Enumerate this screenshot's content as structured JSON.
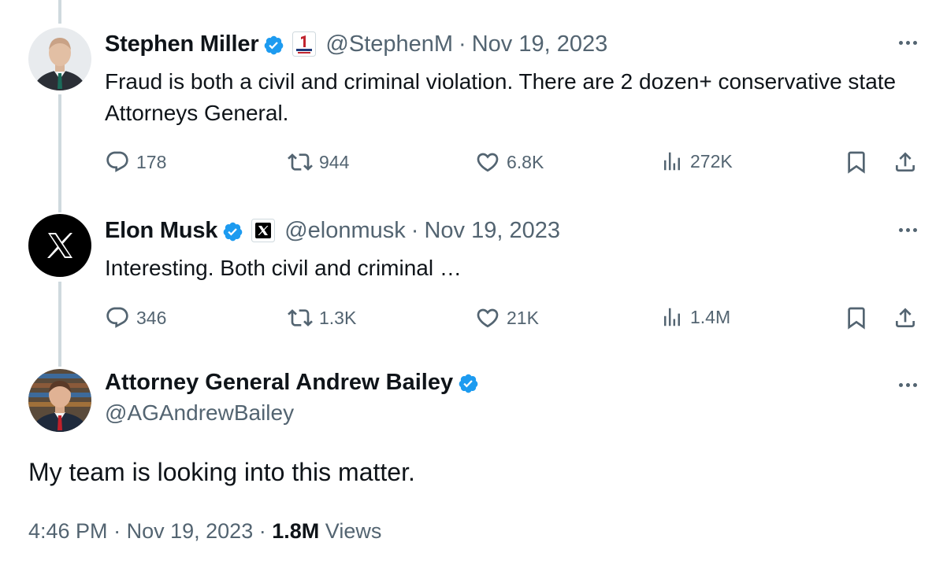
{
  "tweets": [
    {
      "name": "Stephen Miller",
      "handle": "@StephenM",
      "separator": "·",
      "date": "Nov 19, 2023",
      "text": "Fraud is both a civil and criminal violation. There are 2 dozen+ conservative state Attorneys General.",
      "replies": "178",
      "reposts": "944",
      "likes": "6.8K",
      "views": "272K"
    },
    {
      "name": "Elon Musk",
      "handle": "@elonmusk",
      "separator": "·",
      "date": "Nov 19, 2023",
      "text": "Interesting. Both civil and criminal …",
      "replies": "346",
      "reposts": "1.3K",
      "likes": "21K",
      "views": "1.4M"
    }
  ],
  "main": {
    "name": "Attorney General Andrew Bailey",
    "handle": "@AGAndrewBailey",
    "text": "My team is looking into this matter.",
    "time": "4:46 PM",
    "separator": "·",
    "date": "Nov 19, 2023",
    "separator2": "·",
    "view_count": "1.8M",
    "views_label": "Views"
  },
  "icons": [
    "verified-badge-icon",
    "affiliate-badge-icon",
    "x-logo-icon",
    "more-icon",
    "reply-icon",
    "repost-icon",
    "like-icon",
    "views-icon",
    "bookmark-icon",
    "share-icon"
  ],
  "colors": {
    "verified": "#1d9bf0",
    "muted": "#536471",
    "text": "#0f1419",
    "thread_line": "#cfd9de"
  }
}
